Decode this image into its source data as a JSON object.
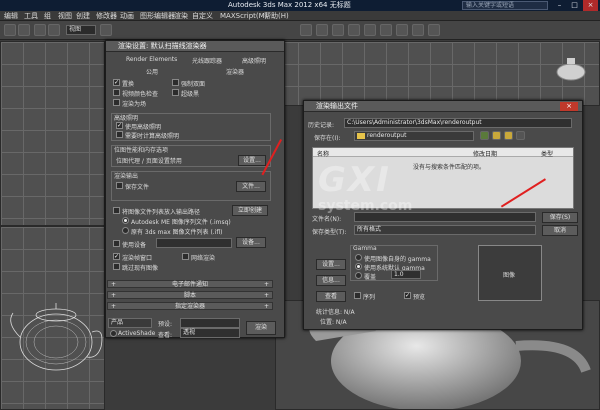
{
  "app": {
    "title": "Autodesk 3ds Max  2012 x64     无标题",
    "search_placeholder": "输入关键字或短语",
    "menu": [
      "编辑",
      "工具",
      "组",
      "视图",
      "创建",
      "修改器",
      "动画",
      "图形编辑器",
      "渲染",
      "自定义",
      "MAXScript(M)",
      "帮助(H)"
    ],
    "toolbar_view_select": "视图"
  },
  "render_setup": {
    "title": "渲染设置: 默认扫描线渲染器",
    "tabs_row1": [
      "Render Elements",
      "光线跟踪器",
      "高级照明"
    ],
    "tabs_row2": [
      "公用",
      "渲染器"
    ],
    "checks": [
      {
        "label": "置换",
        "checked": true
      },
      {
        "label": "强制双面",
        "checked": false
      },
      {
        "label": "视频颜色检查",
        "checked": false
      },
      {
        "label": "超级黑",
        "checked": false
      },
      {
        "label": "渲染为场",
        "checked": false
      }
    ],
    "adv_lighting_group": "高级照明",
    "adv_use": "使用高级照明",
    "adv_compute": "需要时计算高级照明",
    "bitmap_group": "位图性能和内存选项",
    "bitmap_proxy": "位图代理 / 页面设置禁用",
    "bitmap_setup_btn": "设置...",
    "render_output_group": "渲染输出",
    "save_file": "保存文件",
    "files_btn": "文件...",
    "put_images": "将图像文件列表放入输出路径",
    "create_now_btn": "立即创建",
    "autodesk_me": "Autodesk ME 图像序列文件 (.imsq)",
    "legacy_max": "原有 3ds max 图像文件列表 (.ifl)",
    "use_device": "使用设备",
    "device_btn": "设备...",
    "render_frame_window": "渲染帧窗口",
    "net_render": "网络渲染",
    "skip_existing": "跳过现有图像",
    "rollouts": [
      "电子邮件通知",
      "脚本",
      "指定渲染器"
    ],
    "product_label": "产品",
    "preset_label": "预设:",
    "activeshade": "ActiveShade",
    "view_label": "查看:",
    "view_value": "透视",
    "render_btn": "渲染"
  },
  "output_dialog": {
    "title": "渲染输出文件",
    "history_label": "历史记录:",
    "history_value": "C:\\Users\\Administrator\\3dsMax\\renderoutput",
    "save_in_label": "保存在(I):",
    "save_in_value": "renderoutput",
    "columns": [
      "名称",
      "修改日期",
      "类型"
    ],
    "empty_text": "没有与搜索条件匹配的项。",
    "filename_label": "文件名(N):",
    "filename_value": "",
    "filetype_label": "保存类型(T):",
    "filetype_value": "所有格式",
    "save_btn": "保存(S)",
    "cancel_btn": "取消",
    "setup_btn": "设置...",
    "info_btn": "信息...",
    "view_btn": "查看",
    "gamma_group": "Gamma",
    "gamma_own": "使用图像自身的 gamma",
    "gamma_sys": "使用系统默认 gamma",
    "gamma_override": "覆盖",
    "gamma_override_value": "1.0",
    "sequence": "序列",
    "preview": "预览",
    "preview_label": "图像",
    "stats_label": "统计信息: N/A",
    "location_label": "位置: N/A"
  },
  "watermark": {
    "big": "GXI",
    "sub": "system.com"
  }
}
